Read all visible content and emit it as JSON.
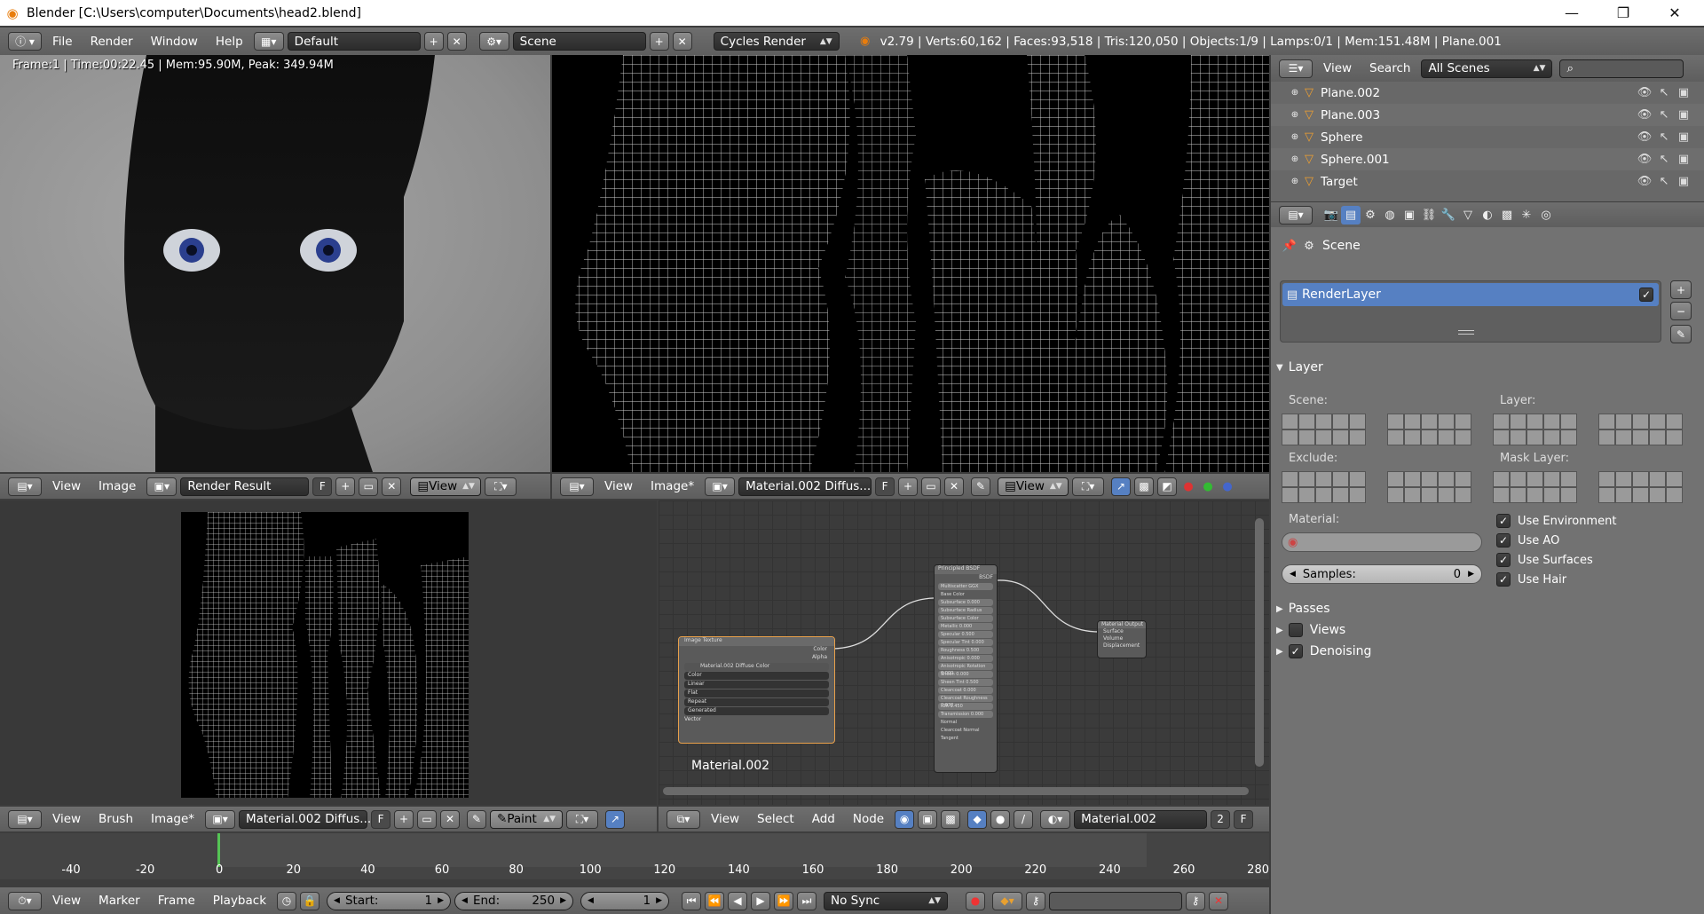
{
  "window": {
    "title": "Blender [C:\\Users\\computer\\Documents\\head2.blend]",
    "minimize": "—",
    "maximize": "❐",
    "close": "✕"
  },
  "topbar": {
    "menus": [
      "File",
      "Render",
      "Window",
      "Help"
    ],
    "layout": "Default",
    "scene": "Scene",
    "engine": "Cycles Render",
    "stats": "v2.79 | Verts:60,162 | Faces:93,518 | Tris:120,050 | Objects:1/9 | Lamps:0/1 | Mem:151.48M | Plane.001"
  },
  "render_view": {
    "overlay": "Frame:1 | Time:00:22.45 | Mem:95.90M, Peak: 349.94M"
  },
  "image_editor_left": {
    "menus": [
      "View",
      "Image"
    ],
    "image": "Render Result",
    "f": "F",
    "view": "View"
  },
  "image_editor_right": {
    "menus": [
      "View",
      "Image*"
    ],
    "image": "Material.002 Diffus...",
    "f": "F",
    "view": "View"
  },
  "uv_editor": {
    "menus": [
      "View",
      "Brush",
      "Image*"
    ],
    "image": "Material.002 Diffus...",
    "f": "F",
    "mode": "Paint"
  },
  "node_editor": {
    "menus": [
      "View",
      "Select",
      "Add",
      "Node"
    ],
    "material": "Material.002",
    "users": "2",
    "f": "F",
    "label": "Material.002",
    "image_node": {
      "title": "Image Texture",
      "out1": "Color",
      "out2": "Alpha",
      "file": "Material.002 Diffuse Color",
      "opts": [
        "Color",
        "Linear",
        "Flat",
        "Repeat",
        "Generated"
      ],
      "input": "Vector"
    },
    "bsdf": {
      "title": "Principled BSDF",
      "out": "BSDF",
      "rows": [
        "Multiscatter GGX",
        "Base Color",
        "Subsurface 0.000",
        "Subsurface Radius",
        "Subsurface Color",
        "Metallic 0.000",
        "Specular 0.500",
        "Specular Tint 0.000",
        "Roughness 0.500",
        "Anisotropic 0.000",
        "Anisotropic Rotation 0.000",
        "Sheen 0.000",
        "Sheen Tint 0.500",
        "Clearcoat 0.000",
        "Clearcoat Roughness 0.030",
        "IOR 1.450",
        "Transmission 0.000",
        "Normal",
        "Clearcoat Normal",
        "Tangent"
      ]
    },
    "output": {
      "title": "Material Output",
      "rows": [
        "Surface",
        "Volume",
        "Displacement"
      ]
    }
  },
  "outliner": {
    "menus": [
      "View",
      "Search"
    ],
    "filter": "All Scenes",
    "items": [
      {
        "name": "Plane.002"
      },
      {
        "name": "Plane.003"
      },
      {
        "name": "Sphere"
      },
      {
        "name": "Sphere.001"
      },
      {
        "name": "Target"
      }
    ]
  },
  "properties": {
    "context": "Scene",
    "renderlayer": "RenderLayer",
    "layer_panel": "Layer",
    "scene_label": "Scene:",
    "layer_label": "Layer:",
    "exclude_label": "Exclude:",
    "mask_label": "Mask Layer:",
    "material_label": "Material:",
    "samples_label": "Samples:",
    "samples_value": "0",
    "use": [
      "Use Environment",
      "Use AO",
      "Use Surfaces",
      "Use Hair"
    ],
    "panels": [
      "Passes",
      "Views",
      "Denoising"
    ]
  },
  "timeline": {
    "ticks": [
      "-40",
      "-20",
      "0",
      "20",
      "40",
      "60",
      "80",
      "100",
      "120",
      "140",
      "160",
      "180",
      "200",
      "220",
      "240",
      "260",
      "280"
    ],
    "menus": [
      "View",
      "Marker",
      "Frame",
      "Playback"
    ],
    "start_label": "Start:",
    "start": "1",
    "end_label": "End:",
    "end": "250",
    "current": "1",
    "sync": "No Sync"
  },
  "colors": {
    "accent": "#5680c2",
    "bg": "#727272",
    "dark": "#3d3d3d"
  }
}
